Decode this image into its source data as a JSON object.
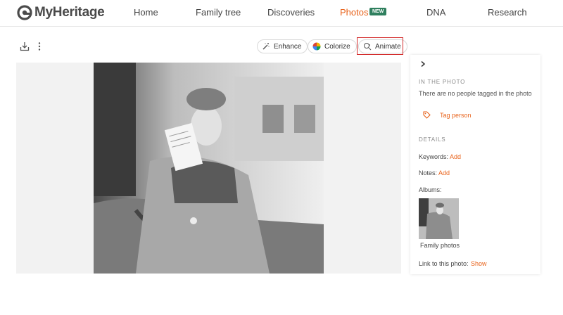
{
  "app": {
    "logo_text": "MyHeritage"
  },
  "nav": {
    "items": [
      {
        "label": "Home",
        "active": false
      },
      {
        "label": "Family tree",
        "active": false
      },
      {
        "label": "Discoveries",
        "active": false
      },
      {
        "label": "Photos",
        "active": true
      },
      {
        "label": "DNA",
        "active": false
      },
      {
        "label": "Research",
        "active": false
      }
    ],
    "badge": "NEW"
  },
  "toolbar": {
    "enhance_label": "Enhance",
    "colorize_label": "Colorize",
    "animate_label": "Animate"
  },
  "sidebar": {
    "in_photo_heading": "IN THE PHOTO",
    "no_people_text": "There are no people tagged in the photo",
    "tag_person_label": "Tag person",
    "details_heading": "DETAILS",
    "keywords_label": "Keywords:",
    "keywords_add": "Add",
    "notes_label": "Notes:",
    "notes_add": "Add",
    "albums_label": "Albums:",
    "album_name": "Family photos",
    "link_label": "Link to this photo:",
    "link_show": "Show"
  },
  "colors": {
    "accent": "#e8621a",
    "badge_green": "#2f7f5e",
    "highlight_red": "#d42d2d"
  }
}
